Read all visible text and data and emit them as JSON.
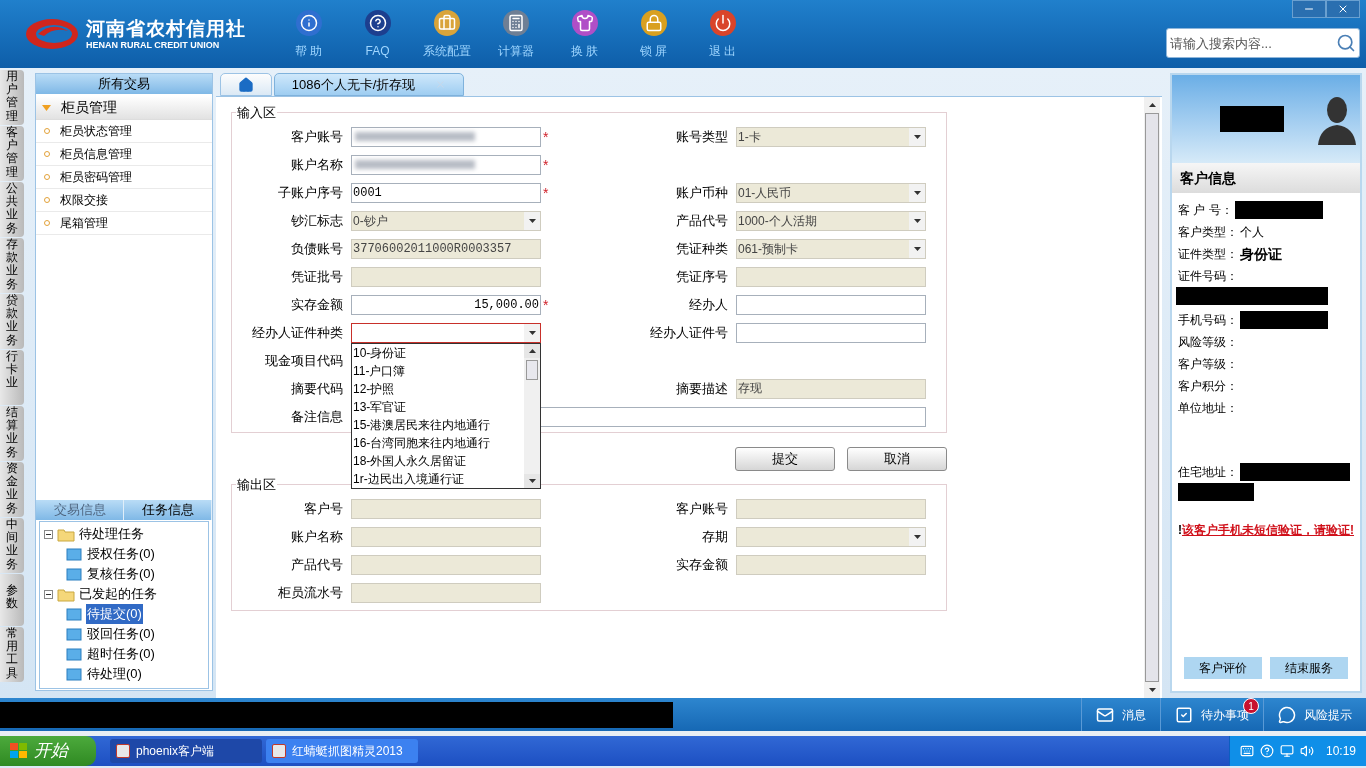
{
  "header": {
    "logo_cn": "河南省农村信用社",
    "logo_en": "HENAN RURAL CREDIT UNION",
    "toolbar": [
      {
        "kind": "info",
        "label": "帮 助"
      },
      {
        "kind": "help",
        "label": "FAQ"
      },
      {
        "kind": "settings",
        "label": "系统配置"
      },
      {
        "kind": "calculator",
        "label": "计算器"
      },
      {
        "kind": "skin",
        "label": "换 肤"
      },
      {
        "kind": "lock",
        "label": "锁 屏"
      },
      {
        "kind": "exit",
        "label": "退 出"
      }
    ],
    "search": {
      "placeholder": "请输入搜索内容..."
    }
  },
  "vertical_tabs": [
    "用户管理",
    "客户管理",
    "公共业务",
    "存款业务",
    "贷款业务",
    "行卡业",
    "结算业务",
    "资金业务",
    "中间业务",
    "参数",
    "常用工具"
  ],
  "left_panel": {
    "title": "所有交易",
    "group": {
      "label": "柜员管理",
      "expanded": true
    },
    "items": [
      "柜员状态管理",
      "柜员信息管理",
      "柜员密码管理",
      "权限交接",
      "尾箱管理"
    ],
    "bottom_tabs": [
      {
        "label": "交易信息",
        "selected": false
      },
      {
        "label": "任务信息",
        "selected": true
      }
    ],
    "tree": [
      {
        "label": "待处理任务",
        "expanded": true,
        "children": [
          {
            "label": "授权任务(0)",
            "selected": false
          },
          {
            "label": "复核任务(0)",
            "selected": false
          }
        ]
      },
      {
        "label": "已发起的任务",
        "expanded": true,
        "children": [
          {
            "label": "待提交(0)",
            "selected": true
          },
          {
            "label": "驳回任务(0)",
            "selected": false
          },
          {
            "label": "超时任务(0)",
            "selected": false
          },
          {
            "label": "待处理(0)",
            "selected": false
          }
        ]
      }
    ]
  },
  "main_tabs": [
    {
      "kind": "home",
      "selected": false
    },
    {
      "kind": "page",
      "label": "1086个人无卡/折存现",
      "selected": true
    }
  ],
  "input_area": {
    "title": "输入区",
    "rows": [
      [
        {
          "label": "客户账号",
          "field": {
            "kind": "text",
            "masked": true,
            "disabled": false,
            "required_mark": "*"
          }
        },
        {
          "label": "账号类型",
          "field": {
            "kind": "select",
            "value": "1-卡",
            "disabled": true
          }
        }
      ],
      [
        {
          "label": "账户名称",
          "field": {
            "kind": "text",
            "masked": true,
            "disabled": false,
            "required_mark": "*"
          }
        }
      ],
      [
        {
          "label": "子账户序号",
          "field": {
            "kind": "text",
            "value": "0001",
            "disabled": false,
            "required_mark": "*"
          }
        },
        {
          "label": "账户币种",
          "field": {
            "kind": "select",
            "value": "01-人民币",
            "disabled": true
          }
        }
      ],
      [
        {
          "label": "钞汇标志",
          "field": {
            "kind": "select",
            "value": "0-钞户",
            "disabled": true
          }
        },
        {
          "label": "产品代号",
          "field": {
            "kind": "select",
            "value": "1000-个人活期",
            "disabled": true
          }
        }
      ],
      [
        {
          "label": "负债账号",
          "field": {
            "kind": "text",
            "value": "37706002011000R0003357",
            "disabled": true
          }
        },
        {
          "label": "凭证种类",
          "field": {
            "kind": "select",
            "value": "061-预制卡",
            "disabled": true
          }
        }
      ],
      [
        {
          "label": "凭证批号",
          "field": {
            "kind": "text",
            "disabled": true
          }
        },
        {
          "label": "凭证序号",
          "field": {
            "kind": "text",
            "disabled": true
          }
        }
      ],
      [
        {
          "label": "实存金额",
          "field": {
            "kind": "amount",
            "value": "15,000.00",
            "disabled": false,
            "required_mark": "*"
          }
        },
        {
          "label": "经办人",
          "field": {
            "kind": "text",
            "disabled": false
          }
        }
      ],
      [
        {
          "label": "经办人证件种类",
          "field": {
            "kind": "select",
            "disabled": false,
            "invalid": true
          }
        },
        {
          "label": "经办人证件号",
          "field": {
            "kind": "text",
            "disabled": false
          }
        }
      ],
      [
        {
          "label": "现金项目代码"
        }
      ],
      [
        {
          "label": "摘要代码"
        },
        {
          "label": "摘要描述",
          "field": {
            "kind": "text",
            "value": "存现",
            "disabled": true
          }
        }
      ],
      [
        {
          "label": "备注信息",
          "field": {
            "kind": "wide",
            "disabled": false
          }
        }
      ]
    ],
    "dropdown": {
      "options": [
        "10-身份证",
        "11-户口簿",
        "12-护照",
        "13-军官证",
        "15-港澳居民来往内地通行",
        "16-台湾同胞来往内地通行",
        "18-外国人永久居留证",
        "1r-边民出入境通行证"
      ]
    }
  },
  "buttons": [
    "提交",
    "取消"
  ],
  "output_area": {
    "title": "输出区",
    "rows": [
      [
        {
          "label": "客户号",
          "field": {
            "kind": "text",
            "disabled": true
          }
        },
        {
          "label": "客户账号",
          "field": {
            "kind": "text",
            "disabled": true
          }
        }
      ],
      [
        {
          "label": "账户名称",
          "field": {
            "kind": "text",
            "disabled": true
          }
        },
        {
          "label": "存期",
          "field": {
            "kind": "select",
            "disabled": true
          }
        }
      ],
      [
        {
          "label": "产品代号",
          "field": {
            "kind": "text",
            "disabled": true
          }
        },
        {
          "label": "实存金额",
          "field": {
            "kind": "text",
            "disabled": true
          }
        }
      ],
      [
        {
          "label": "柜员流水号",
          "field": {
            "kind": "text",
            "disabled": true
          }
        }
      ]
    ]
  },
  "customer_panel": {
    "title": "客户信息",
    "rows": [
      {
        "label": "客 户 号：",
        "redacted_inline": true
      },
      {
        "label": "客户类型：",
        "value": "个人"
      },
      {
        "label": "证件类型：",
        "value": "身份证",
        "emphasis": true
      },
      {
        "label": "证件号码：",
        "redacted_below": true
      },
      {
        "label": "手机号码：",
        "redacted_inline": true
      },
      {
        "label": "风险等级："
      },
      {
        "label": "客户等级："
      },
      {
        "label": "客户积分："
      },
      {
        "label": "单位地址："
      },
      {
        "label": "住宅地址：",
        "redacted_inline": true,
        "redacted_below": true
      }
    ],
    "warning": {
      "mark": "!",
      "text": "该客户手机未短信验证，请验证!"
    },
    "buttons": [
      "客户评价",
      "结束服务"
    ]
  },
  "status_bar": [
    {
      "kind": "message",
      "label": "消息"
    },
    {
      "kind": "todo",
      "label": "待办事项",
      "badge": "1"
    },
    {
      "kind": "risk",
      "label": "风险提示"
    }
  ],
  "taskbar": {
    "start": "开始",
    "tasks": [
      {
        "label": "phoenix客户端",
        "selected": true
      },
      {
        "label": "红蜻蜓抓图精灵2013",
        "selected": false
      }
    ],
    "clock": "10:19"
  }
}
